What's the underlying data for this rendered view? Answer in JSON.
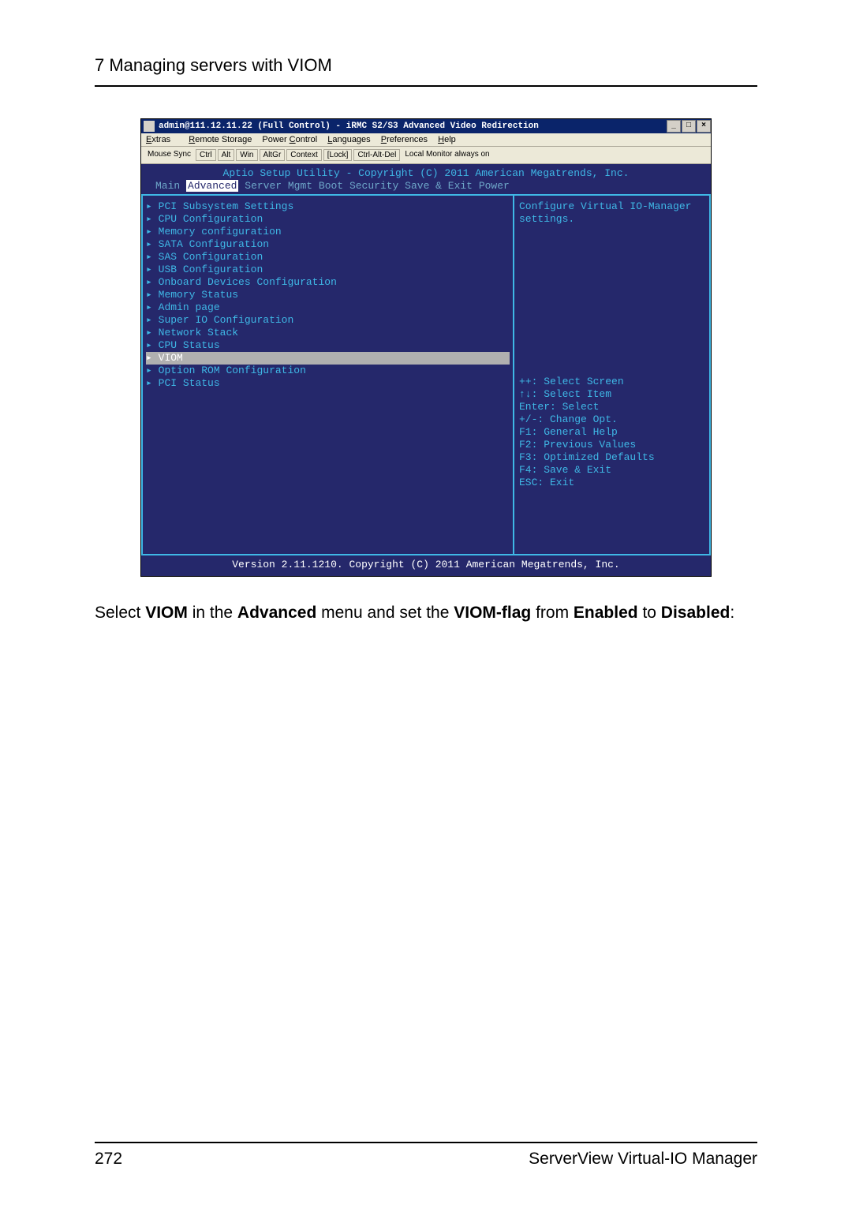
{
  "page": {
    "section_title": "7 Managing servers with VIOM",
    "number": "272",
    "footer_right": "ServerView Virtual-IO Manager"
  },
  "window": {
    "title": "admin@111.12.11.22 (Full Control) - iRMC S2/S3 Advanced Video Redirection",
    "btn_min": "_",
    "btn_max": "□",
    "btn_close": "×"
  },
  "menubar": {
    "items": [
      "Extras",
      "Remote Storage",
      "Power Control",
      "Languages",
      "Preferences",
      "Help"
    ]
  },
  "toolbar": {
    "mouse_sync": "Mouse Sync",
    "buttons": [
      "Ctrl",
      "Alt",
      "Win",
      "AltGr",
      "Context",
      "[Lock]",
      "Ctrl-Alt-Del"
    ],
    "end_label": "Local Monitor always on"
  },
  "bios": {
    "header": "Aptio Setup Utility - Copyright (C) 2011 American Megatrends, Inc.",
    "tabs": [
      "Main",
      "Advanced",
      "Server Mgmt",
      "Boot",
      "Security",
      "Save & Exit",
      "Power"
    ],
    "active_tab": "Advanced",
    "items": [
      "PCI Subsystem Settings",
      "CPU Configuration",
      "Memory configuration",
      "SATA Configuration",
      "SAS Configuration",
      "USB Configuration",
      "Onboard Devices Configuration",
      "Memory Status",
      "Admin page",
      "Super IO Configuration",
      "Network Stack",
      "CPU Status",
      "VIOM",
      "Option ROM Configuration",
      "PCI Status"
    ],
    "selected_index": 12,
    "right_help_top": "Configure Virtual IO-Manager settings.",
    "help_lines": [
      "++: Select Screen",
      "↑↓: Select Item",
      "Enter: Select",
      "+/-: Change Opt.",
      "F1: General Help",
      "F2: Previous Values",
      "F3: Optimized Defaults",
      "F4: Save & Exit",
      "ESC: Exit"
    ],
    "footer": "Version 2.11.1210. Copyright (C) 2011 American Megatrends, Inc."
  },
  "caption": {
    "pre": "Select ",
    "b1": "VIOM",
    "mid1": " in the ",
    "b2": "Advanced",
    "mid2": " menu and set the ",
    "b3": "VIOM-flag",
    "mid3": " from ",
    "b4": "Enabled",
    "mid4": " to ",
    "b5": "Disabled",
    "end": ":"
  }
}
